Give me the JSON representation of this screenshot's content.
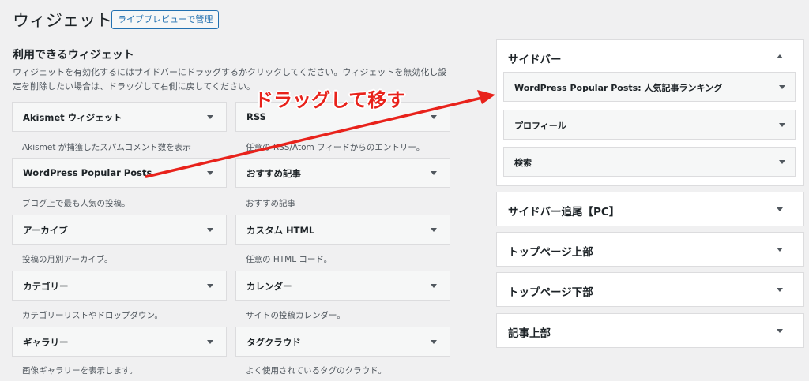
{
  "header": {
    "title": "ウィジェット",
    "live_preview_label": "ライブプレビューで管理"
  },
  "available": {
    "title": "利用できるウィジェット",
    "description": "ウィジェットを有効化するにはサイドバーにドラッグするかクリックしてください。ウィジェットを無効化し設定を削除したい場合は、ドラッグして右側に戻してください。"
  },
  "widgets": [
    {
      "name": "Akismet ウィジェット",
      "desc": "Akismet が捕獲したスパムコメント数を表示"
    },
    {
      "name": "RSS",
      "desc": "任意の RSS/Atom フィードからのエントリー。"
    },
    {
      "name": "WordPress Popular Posts",
      "desc": "ブログ上で最も人気の投稿。"
    },
    {
      "name": "おすすめ記事",
      "desc": "おすすめ記事"
    },
    {
      "name": "アーカイブ",
      "desc": "投稿の月別アーカイブ。"
    },
    {
      "name": "カスタム HTML",
      "desc": "任意の HTML コード。"
    },
    {
      "name": "カテゴリー",
      "desc": "カテゴリーリストやドロップダウン。"
    },
    {
      "name": "カレンダー",
      "desc": "サイトの投稿カレンダー。"
    },
    {
      "name": "ギャラリー",
      "desc": "画像ギャラリーを表示します。"
    },
    {
      "name": "タグクラウド",
      "desc": "よく使用されているタグのクラウド。"
    }
  ],
  "sidebar": {
    "title": "サイドバー",
    "widgets": [
      "WordPress Popular Posts: 人気記事ランキング",
      "プロフィール",
      "検索"
    ]
  },
  "areas": [
    "サイドバー追尾【PC】",
    "トップページ上部",
    "トップページ下部",
    "記事上部"
  ],
  "annotation": {
    "text": "ドラッグして移す",
    "color": "#e8221b"
  },
  "colors": {
    "accent": "#2271b1",
    "background": "#f0f0f1"
  }
}
